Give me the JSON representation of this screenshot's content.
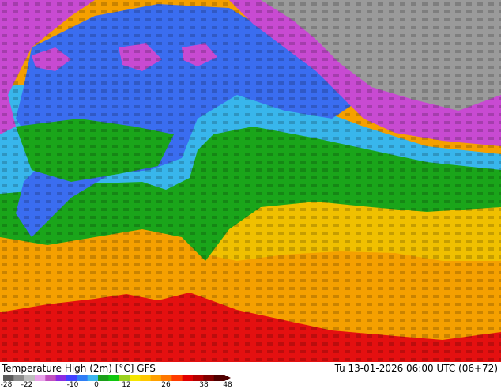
{
  "map": {
    "title": "Temperature High (2m) [°C] GFS",
    "run_info": "Tu 13-01-2026 06:00 UTC (06+72)"
  },
  "colorbar": {
    "ticks": [
      "-28",
      "-22",
      "-10",
      "0",
      "12",
      "26",
      "38",
      "48"
    ],
    "colors": [
      "#5a5a5a",
      "#8c8c8c",
      "#bebebe",
      "#e8a0e8",
      "#c050c0",
      "#8a2be2",
      "#4040ff",
      "#2f7df6",
      "#3db7f0",
      "#1aa01a",
      "#0fc80f",
      "#9bd21e",
      "#f5e600",
      "#ffc800",
      "#ffa000",
      "#ff7800",
      "#ff3c00",
      "#e10000",
      "#b40000",
      "#820000",
      "#500000"
    ]
  },
  "palette": {
    "grey": "#9a9a9a",
    "magenta": "#c84ad2",
    "violet": "#a43cd8",
    "blue": "#3a6df0",
    "lightblue": "#38b6ec",
    "green": "#1aa51a",
    "brightgreen": "#00c800",
    "yellow": "#f0e000",
    "orange": "#f5a000",
    "red": "#e41010"
  }
}
